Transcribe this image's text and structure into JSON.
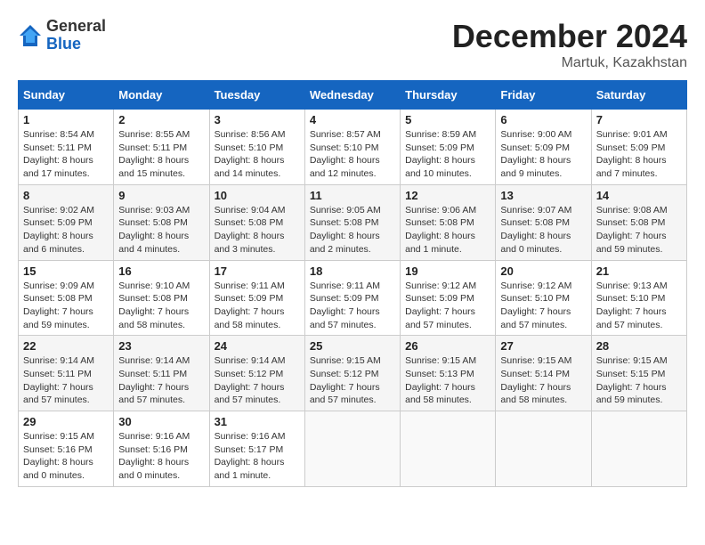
{
  "header": {
    "logo_general": "General",
    "logo_blue": "Blue",
    "month_title": "December 2024",
    "location": "Martuk, Kazakhstan"
  },
  "days_of_week": [
    "Sunday",
    "Monday",
    "Tuesday",
    "Wednesday",
    "Thursday",
    "Friday",
    "Saturday"
  ],
  "weeks": [
    [
      {
        "day": "1",
        "info": "Sunrise: 8:54 AM\nSunset: 5:11 PM\nDaylight: 8 hours and 17 minutes."
      },
      {
        "day": "2",
        "info": "Sunrise: 8:55 AM\nSunset: 5:11 PM\nDaylight: 8 hours and 15 minutes."
      },
      {
        "day": "3",
        "info": "Sunrise: 8:56 AM\nSunset: 5:10 PM\nDaylight: 8 hours and 14 minutes."
      },
      {
        "day": "4",
        "info": "Sunrise: 8:57 AM\nSunset: 5:10 PM\nDaylight: 8 hours and 12 minutes."
      },
      {
        "day": "5",
        "info": "Sunrise: 8:59 AM\nSunset: 5:09 PM\nDaylight: 8 hours and 10 minutes."
      },
      {
        "day": "6",
        "info": "Sunrise: 9:00 AM\nSunset: 5:09 PM\nDaylight: 8 hours and 9 minutes."
      },
      {
        "day": "7",
        "info": "Sunrise: 9:01 AM\nSunset: 5:09 PM\nDaylight: 8 hours and 7 minutes."
      }
    ],
    [
      {
        "day": "8",
        "info": "Sunrise: 9:02 AM\nSunset: 5:09 PM\nDaylight: 8 hours and 6 minutes."
      },
      {
        "day": "9",
        "info": "Sunrise: 9:03 AM\nSunset: 5:08 PM\nDaylight: 8 hours and 4 minutes."
      },
      {
        "day": "10",
        "info": "Sunrise: 9:04 AM\nSunset: 5:08 PM\nDaylight: 8 hours and 3 minutes."
      },
      {
        "day": "11",
        "info": "Sunrise: 9:05 AM\nSunset: 5:08 PM\nDaylight: 8 hours and 2 minutes."
      },
      {
        "day": "12",
        "info": "Sunrise: 9:06 AM\nSunset: 5:08 PM\nDaylight: 8 hours and 1 minute."
      },
      {
        "day": "13",
        "info": "Sunrise: 9:07 AM\nSunset: 5:08 PM\nDaylight: 8 hours and 0 minutes."
      },
      {
        "day": "14",
        "info": "Sunrise: 9:08 AM\nSunset: 5:08 PM\nDaylight: 7 hours and 59 minutes."
      }
    ],
    [
      {
        "day": "15",
        "info": "Sunrise: 9:09 AM\nSunset: 5:08 PM\nDaylight: 7 hours and 59 minutes."
      },
      {
        "day": "16",
        "info": "Sunrise: 9:10 AM\nSunset: 5:08 PM\nDaylight: 7 hours and 58 minutes."
      },
      {
        "day": "17",
        "info": "Sunrise: 9:11 AM\nSunset: 5:09 PM\nDaylight: 7 hours and 58 minutes."
      },
      {
        "day": "18",
        "info": "Sunrise: 9:11 AM\nSunset: 5:09 PM\nDaylight: 7 hours and 57 minutes."
      },
      {
        "day": "19",
        "info": "Sunrise: 9:12 AM\nSunset: 5:09 PM\nDaylight: 7 hours and 57 minutes."
      },
      {
        "day": "20",
        "info": "Sunrise: 9:12 AM\nSunset: 5:10 PM\nDaylight: 7 hours and 57 minutes."
      },
      {
        "day": "21",
        "info": "Sunrise: 9:13 AM\nSunset: 5:10 PM\nDaylight: 7 hours and 57 minutes."
      }
    ],
    [
      {
        "day": "22",
        "info": "Sunrise: 9:14 AM\nSunset: 5:11 PM\nDaylight: 7 hours and 57 minutes."
      },
      {
        "day": "23",
        "info": "Sunrise: 9:14 AM\nSunset: 5:11 PM\nDaylight: 7 hours and 57 minutes."
      },
      {
        "day": "24",
        "info": "Sunrise: 9:14 AM\nSunset: 5:12 PM\nDaylight: 7 hours and 57 minutes."
      },
      {
        "day": "25",
        "info": "Sunrise: 9:15 AM\nSunset: 5:12 PM\nDaylight: 7 hours and 57 minutes."
      },
      {
        "day": "26",
        "info": "Sunrise: 9:15 AM\nSunset: 5:13 PM\nDaylight: 7 hours and 58 minutes."
      },
      {
        "day": "27",
        "info": "Sunrise: 9:15 AM\nSunset: 5:14 PM\nDaylight: 7 hours and 58 minutes."
      },
      {
        "day": "28",
        "info": "Sunrise: 9:15 AM\nSunset: 5:15 PM\nDaylight: 7 hours and 59 minutes."
      }
    ],
    [
      {
        "day": "29",
        "info": "Sunrise: 9:15 AM\nSunset: 5:16 PM\nDaylight: 8 hours and 0 minutes."
      },
      {
        "day": "30",
        "info": "Sunrise: 9:16 AM\nSunset: 5:16 PM\nDaylight: 8 hours and 0 minutes."
      },
      {
        "day": "31",
        "info": "Sunrise: 9:16 AM\nSunset: 5:17 PM\nDaylight: 8 hours and 1 minute."
      },
      {
        "day": "",
        "info": ""
      },
      {
        "day": "",
        "info": ""
      },
      {
        "day": "",
        "info": ""
      },
      {
        "day": "",
        "info": ""
      }
    ]
  ]
}
